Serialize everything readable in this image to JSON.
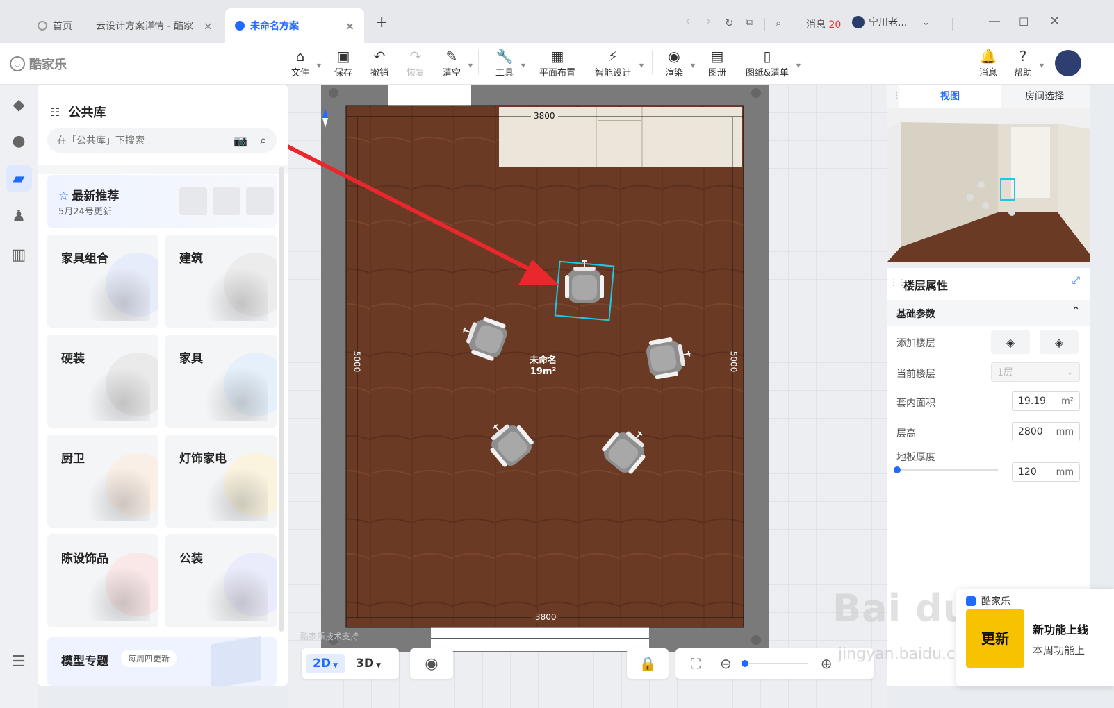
{
  "browser": {
    "tabs": [
      {
        "label": "首页"
      },
      {
        "label": "云设计方案详情 - 酷家"
      },
      {
        "label": "未命名方案"
      }
    ],
    "new_tab": "+",
    "messages_label": "消息",
    "messages_count": "20",
    "user_name": "宁川老..."
  },
  "app": {
    "logo": "酷家乐",
    "tools": [
      {
        "label": "文件",
        "icon": "home-icon"
      },
      {
        "label": "保存",
        "icon": "save-icon"
      },
      {
        "label": "撤销",
        "icon": "undo-icon"
      },
      {
        "label": "恢复",
        "icon": "redo-icon"
      },
      {
        "label": "清空",
        "icon": "eraser-icon"
      },
      {
        "label": "工具",
        "icon": "wrench-icon"
      },
      {
        "label": "平面布置",
        "icon": "layout-icon"
      },
      {
        "label": "智能设计",
        "icon": "lightning-icon"
      },
      {
        "label": "渲染",
        "icon": "camera-icon"
      },
      {
        "label": "图册",
        "icon": "album-icon"
      },
      {
        "label": "图纸&清单",
        "icon": "document-icon"
      }
    ],
    "right_tools": [
      {
        "label": "消息",
        "icon": "bell-icon"
      },
      {
        "label": "帮助",
        "icon": "help-icon"
      }
    ]
  },
  "library": {
    "title": "公共库",
    "search_placeholder": "在「公共库」下搜索",
    "recommend_title": "最新推荐",
    "recommend_sub": "5月24号更新",
    "categories": [
      {
        "label": "家具组合",
        "accent": "#d9e3ff"
      },
      {
        "label": "建筑",
        "accent": "#e4e4e4"
      },
      {
        "label": "硬装",
        "accent": "#e0e0e0"
      },
      {
        "label": "家具",
        "accent": "#d6ecff"
      },
      {
        "label": "厨卫",
        "accent": "#ffe9d6"
      },
      {
        "label": "灯饰家电",
        "accent": "#fff4c8"
      },
      {
        "label": "陈设饰品",
        "accent": "#ffd9d9"
      },
      {
        "label": "公装",
        "accent": "#e2e4ff"
      }
    ],
    "topic_title": "模型专题",
    "topic_badge": "每周四更新"
  },
  "canvas": {
    "dim_top": "3800",
    "dim_bottom": "3800",
    "dim_left": "5000",
    "dim_right": "5000",
    "room_name": "未命名",
    "room_area": "19m²",
    "support_text": "酷家乐技术支持",
    "modes": [
      "2D",
      "3D"
    ]
  },
  "right_panel": {
    "tabs": [
      "视图",
      "房间选择"
    ],
    "props_title": "楼层属性",
    "section": "基础参数",
    "rows": {
      "add_floor": "添加楼层",
      "current_floor": "当前楼层",
      "current_floor_value": "1层",
      "inner_area": "套内面积",
      "inner_area_value": "19.19",
      "inner_area_unit": "m²",
      "floor_height": "层高",
      "floor_height_value": "2800",
      "floor_height_unit": "mm",
      "slab": "地板厚度",
      "slab_value": "120",
      "slab_unit": "mm"
    }
  },
  "toast": {
    "app": "酷家乐",
    "image_text": "更新",
    "title": "新功能上线",
    "body": "本周功能上"
  },
  "watermark": {
    "main": "Bai du 经验",
    "sub": "jingyan.baidu.com"
  }
}
